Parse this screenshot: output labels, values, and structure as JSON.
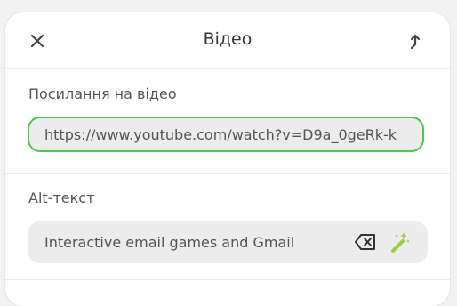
{
  "header": {
    "title": "Відео"
  },
  "video_link": {
    "label": "Посилання на відео",
    "value": "https://www.youtube.com/watch?v=D9a_0geRk-k"
  },
  "alt_text": {
    "label": "Alt-текст",
    "value": "Interactive email games and Gmail"
  },
  "icons": {
    "close": "close-icon",
    "share": "share-arrow-icon",
    "clear": "backspace-clear-icon",
    "magic": "magic-wand-icon"
  },
  "colors": {
    "focus_border": "#4cc74f",
    "magic_icon": "#9ccc3c"
  }
}
